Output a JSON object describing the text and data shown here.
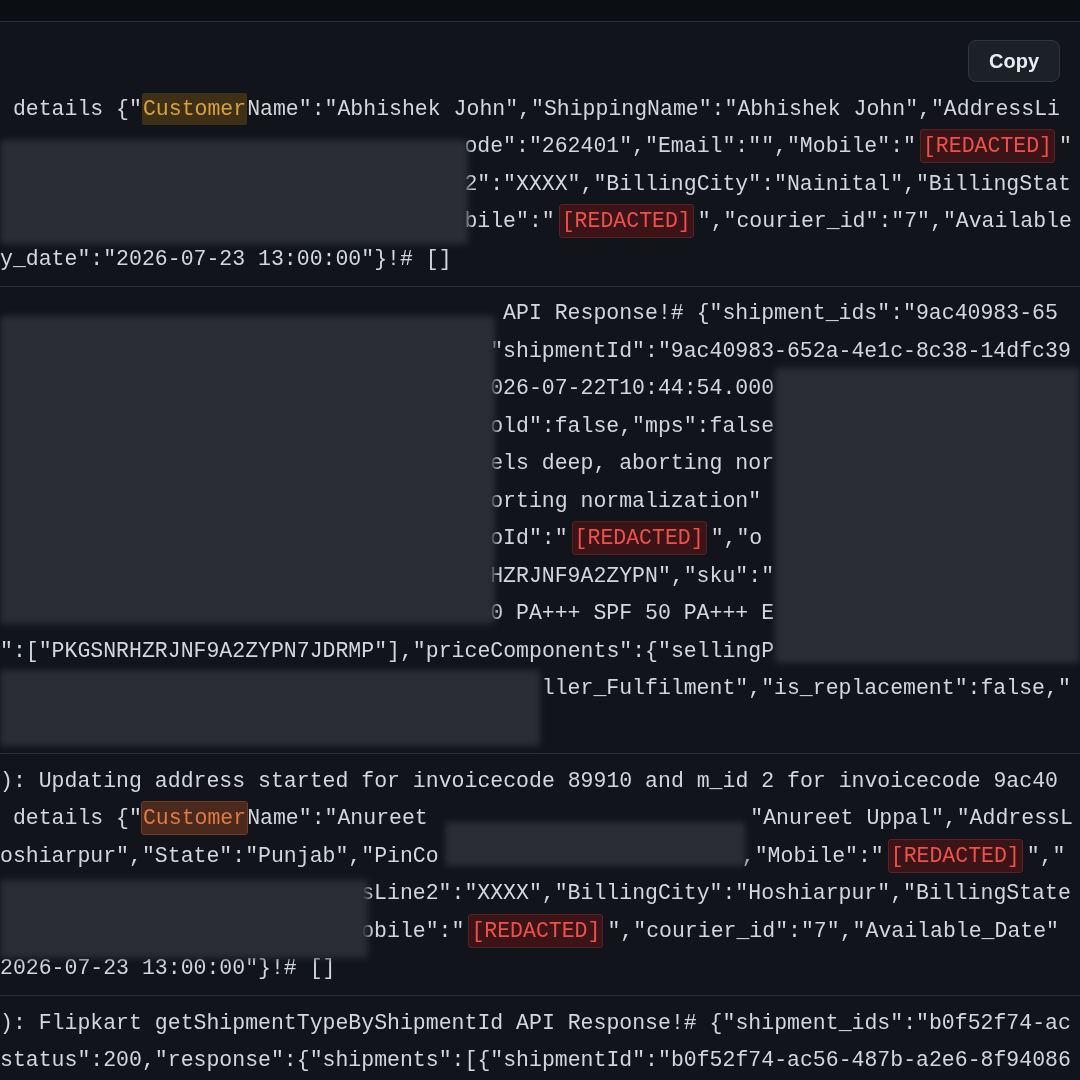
{
  "toolbar": {
    "copy_button": "Copy"
  },
  "entries": [
    {
      "lines": [
        {
          "runs": [
            [
              {
                "kind": "text",
                "text": "details {\""
              },
              {
                "kind": "match",
                "text": "Customer",
                "current": false
              },
              {
                "kind": "text",
                "text": "Name\":\"Abhishek John\",\"ShippingName\":\"Abhishek John\",\"AddressLi"
              }
            ]
          ]
        },
        {
          "runs": [
            [
              {
                "kind": "text",
                "text": "ode\":\"262401\",\"Email\":\"\",\"Mobile\":\""
              },
              {
                "kind": "redacted",
                "text": "[REDACTED]"
              },
              {
                "kind": "text",
                "text": "\""
              }
            ]
          ]
        },
        {
          "runs": [
            [
              {
                "kind": "text",
                "text": "2\":\"XXXX\",\"BillingCity\":\"Nainital\",\"BillingStat"
              }
            ]
          ]
        },
        {
          "runs": [
            [
              {
                "kind": "text",
                "text": "bile\":\""
              },
              {
                "kind": "redacted",
                "text": "[REDACTED]"
              },
              {
                "kind": "text",
                "text": "\",\"courier_id\":\"7\",\"Available"
              }
            ]
          ]
        },
        {
          "runs": [
            [
              {
                "kind": "text",
                "text": "y_date\":\"2026-07-23 13:00:00\"}!# []"
              }
            ]
          ]
        }
      ]
    },
    {
      "lines": [
        {
          "runs": [
            [
              {
                "kind": "text",
                "text": "API Response!# {\"shipment_ids\":\"9ac40983-65"
              }
            ]
          ]
        },
        {
          "runs": [
            [
              {
                "kind": "text",
                "text": "\"shipmentId\":\"9ac40983-652a-4e1c-8c38-14dfc39"
              }
            ]
          ]
        },
        {
          "runs": [
            [
              {
                "kind": "text",
                "text": "026-07-22T10:44:54.000"
              }
            ]
          ]
        },
        {
          "runs": [
            [
              {
                "kind": "text",
                "text": "old\":false,\"mps\":false"
              }
            ]
          ]
        },
        {
          "runs": [
            [
              {
                "kind": "text",
                "text": "els deep, aborting nor"
              }
            ]
          ]
        },
        {
          "runs": [
            [
              {
                "kind": "text",
                "text": "orting normalization\""
              }
            ]
          ]
        },
        {
          "runs": [
            [
              {
                "kind": "text",
                "text": "oId\":\""
              },
              {
                "kind": "redacted",
                "text": "[REDACTED]"
              },
              {
                "kind": "text",
                "text": "\",\"o"
              }
            ]
          ]
        },
        {
          "runs": [
            [
              {
                "kind": "text",
                "text": "HZRJNF9A2ZYPN\",\"sku\":\""
              }
            ]
          ]
        },
        {
          "runs": [
            [
              {
                "kind": "text",
                "text": "0 PA+++ SPF 50 PA+++ E"
              }
            ]
          ]
        },
        {
          "runs": [
            [
              {
                "kind": "text",
                "text": "\":[\"PKGSNRHZRJNF9A2ZYPN7JDRMP\"],\"priceComponents\":{\"sellingP"
              }
            ]
          ]
        },
        {
          "runs": [
            [
              {
                "kind": "text",
                "text": "ller_Fulfilment\",\"is_replacement\":false,\""
              }
            ]
          ]
        }
      ]
    },
    {
      "lines": [
        {
          "runs": [
            [
              {
                "kind": "text",
                "text": "): Updating address started for invoicecode 89910 and m_id 2 for invoicecode 9ac40"
              }
            ]
          ]
        },
        {
          "runs": [
            [
              {
                "kind": "text",
                "text": "details {\""
              },
              {
                "kind": "match",
                "text": "Customer",
                "current": true
              },
              {
                "kind": "text",
                "text": "Name\":\"Anureet"
              }
            ],
            [
              {
                "kind": "text",
                "text": "\"Anureet Uppal\",\"AddressL"
              }
            ]
          ]
        },
        {
          "runs": [
            [
              {
                "kind": "text",
                "text": "oshiarpur\",\"State\":\"Punjab\",\"PinCo"
              }
            ],
            [
              {
                "kind": "text",
                "text": ",\"Mobile\":\""
              },
              {
                "kind": "redacted",
                "text": "[REDACTED]"
              },
              {
                "kind": "text",
                "text": "\",\""
              }
            ]
          ]
        },
        {
          "runs": [
            [
              {
                "kind": "text",
                "text": "sLine2\":\"XXXX\",\"BillingCity\":\"Hoshiarpur\",\"BillingState"
              }
            ]
          ]
        },
        {
          "runs": [
            [
              {
                "kind": "text",
                "text": "obile\":\""
              },
              {
                "kind": "redacted",
                "text": "[REDACTED]"
              },
              {
                "kind": "text",
                "text": "\",\"courier_id\":\"7\",\"Available_Date\""
              }
            ]
          ]
        },
        {
          "runs": [
            [
              {
                "kind": "text",
                "text": "2026-07-23 13:00:00\"}!# []"
              }
            ]
          ]
        }
      ]
    },
    {
      "lines": [
        {
          "runs": [
            [
              {
                "kind": "text",
                "text": "): Flipkart getShipmentTypeByShipmentId API Response!# {\"shipment_ids\":\"b0f52f74-ac"
              }
            ]
          ]
        },
        {
          "runs": [
            [
              {
                "kind": "text",
                "text": "status\":200,\"response\":{\"shipments\":[{\"shipmentId\":\"b0f52f74-ac56-487b-a2e6-8f94086"
              }
            ]
          ]
        }
      ]
    }
  ]
}
